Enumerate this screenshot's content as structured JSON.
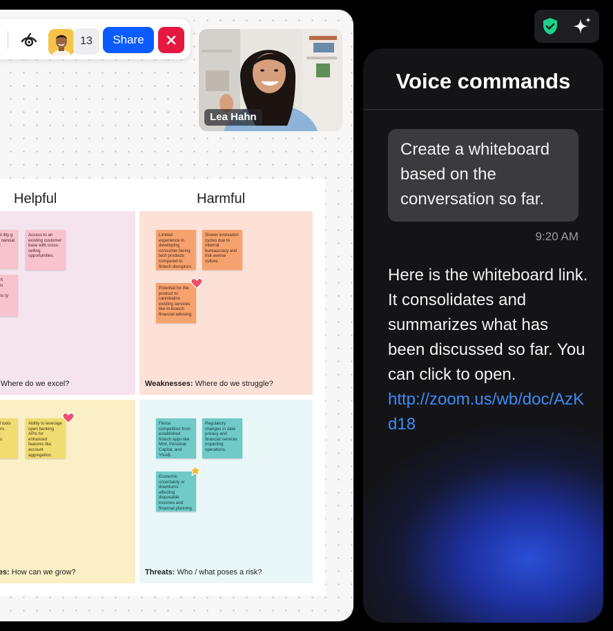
{
  "toolbar": {
    "participant_count": "13",
    "share_label": "Share",
    "close_icon": "close-icon",
    "view_icon": "eye-icon"
  },
  "video": {
    "participant_name": "Lea Hahn"
  },
  "whiteboard": {
    "columns": [
      "Helpful",
      "Harmful"
    ],
    "quadrants": {
      "strengths": {
        "label_bold": "s:",
        "label_text": " Where do we excel?",
        "notes": [
          "ed trust ility g a well- nancial rovider.",
          "Access to an existing customer base with cross-selling opportunities.",
          "lopment features wered ndations ty ments."
        ]
      },
      "weaknesses": {
        "label_bold": "Weaknesses:",
        "label_text": " Where do we struggle?",
        "notes": [
          "Limited experience in developing consumer-facing tech products compared to fintech disruptors.",
          "Slower innovation cycles due to internal bureaucracy and risk-averse culture.",
          "Potential for the product to cannibalize existing services like in-branch financial advising."
        ]
      },
      "opportunities": {
        "label_bold": "ities:",
        "label_text": " How can we grow?",
        "notes": [
          "emand tools to umers udgets savings.",
          "Ability to leverage open banking APIs for enhanced features like account aggregation."
        ]
      },
      "threats": {
        "label_bold": "Threats:",
        "label_text": " Who / what poses a risk?",
        "notes": [
          "Fierce competition from established fintech apps like Mint, Personal Capital, and YNAB.",
          "Regulatory changes in data privacy and financial services impacting operations.",
          "Economic uncertainty or downturns affecting disposable incomes and financial planning behaviors."
        ]
      }
    }
  },
  "voice_panel": {
    "title": "Voice commands",
    "user_message": "Create a whiteboard based on the conversation so far.",
    "timestamp": "9:20 AM",
    "reply_text": "Here is the whiteboard link. It consolidates and summarizes what has been discussed so far. You can click to open.",
    "reply_link": "http://zoom.us/wb/doc/AzKd18"
  },
  "chip": {
    "shield_icon": "shield-check-icon",
    "sparkle_icon": "sparkle-icon",
    "shield_color": "#1fd18b"
  }
}
